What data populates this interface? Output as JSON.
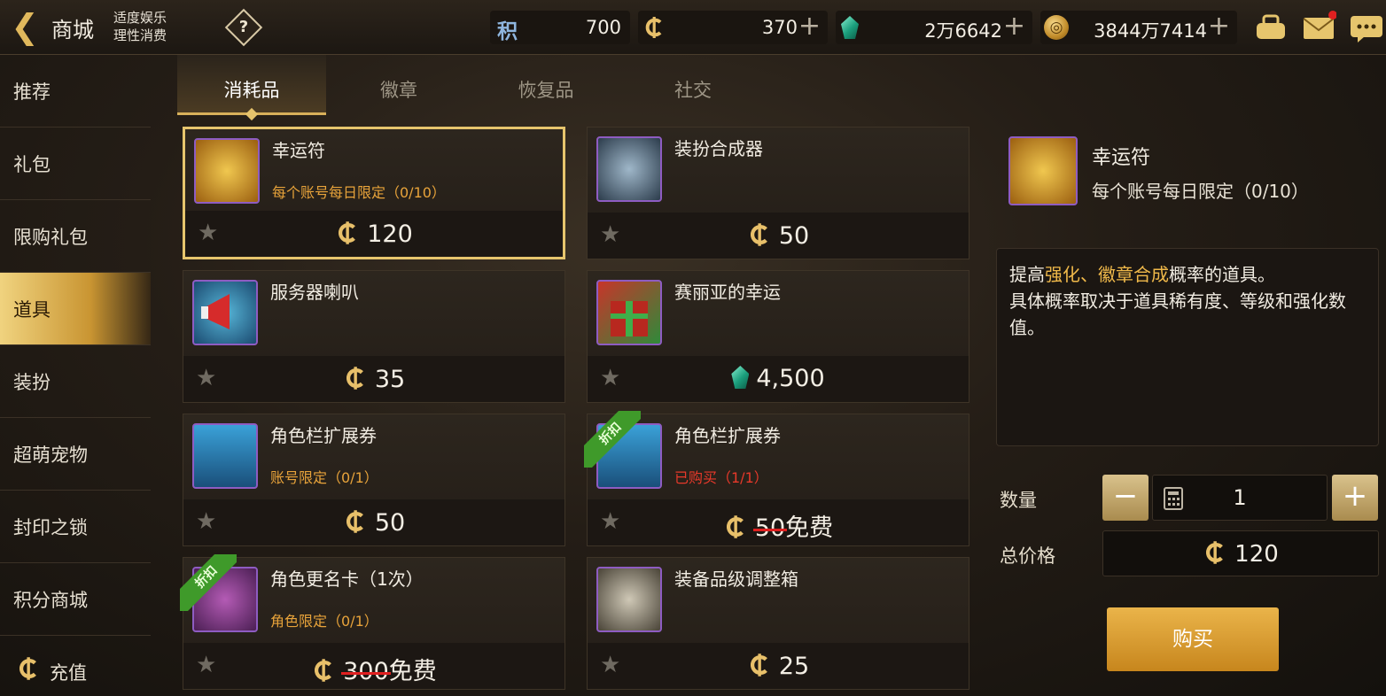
{
  "header": {
    "back_icon": "back-arrow-icon",
    "title": "商城",
    "notice_line1": "适度娱乐",
    "notice_line2": "理性消费",
    "help_icon": "question-icon"
  },
  "currencies": [
    {
      "icon": "points-icon",
      "icon_text": "积",
      "value": "700"
    },
    {
      "icon": "c-coin-icon",
      "value": "370",
      "has_plus": true
    },
    {
      "icon": "gem-icon",
      "value": "2万6642",
      "has_plus": true
    },
    {
      "icon": "gold-coin-icon",
      "value": "3844万7414",
      "has_plus": true
    }
  ],
  "top_icons": [
    "inventory-icon",
    "mail-icon",
    "chat-icon"
  ],
  "sidebar": [
    {
      "label": "推荐"
    },
    {
      "label": "礼包"
    },
    {
      "label": "限购礼包"
    },
    {
      "label": "道具",
      "active": true
    },
    {
      "label": "装扮"
    },
    {
      "label": "超萌宠物"
    },
    {
      "label": "封印之锁"
    },
    {
      "label": "积分商城"
    },
    {
      "label": "充值"
    }
  ],
  "tabs": [
    {
      "label": "消耗品",
      "active": true
    },
    {
      "label": "徽章"
    },
    {
      "label": "恢复品"
    },
    {
      "label": "社交"
    }
  ],
  "items": [
    {
      "name": "幸运符",
      "limit": "每个账号每日限定（0/10）",
      "price": "120",
      "currency": "c"
    },
    {
      "name": "装扮合成器",
      "limit": "",
      "price": "50",
      "currency": "c"
    },
    {
      "name": "服务器喇叭",
      "limit": "",
      "price": "35",
      "currency": "c"
    },
    {
      "name": "赛丽亚的幸运",
      "limit": "",
      "price": "4,500",
      "currency": "gem"
    },
    {
      "name": "角色栏扩展券",
      "limit": "账号限定（0/1）",
      "price": "50",
      "currency": "c"
    },
    {
      "name": "角色栏扩展券",
      "limit": "已购买（1/1）",
      "old_price": "50",
      "price": "免费",
      "currency": "c",
      "ribbon": "折扣"
    },
    {
      "name": "角色更名卡（1次）",
      "limit": "角色限定（0/1）",
      "old_price": "300",
      "price": "免费",
      "currency": "c",
      "ribbon": "折扣"
    },
    {
      "name": "装备品级调整箱",
      "limit": "",
      "price": "25",
      "currency": "c"
    }
  ],
  "detail": {
    "name": "幸运符",
    "limit": "每个账号每日限定（0/10）",
    "desc_pre": "提高",
    "desc_hl": "强化、徽章合成",
    "desc_post": "概率的道具。",
    "desc_line2": "具体概率取决于道具稀有度、等级和强化数值。",
    "quantity_label": "数量",
    "quantity": "1",
    "total_label": "总价格",
    "total": "120",
    "buy_label": "购买"
  },
  "colors": {
    "accent": "#e6c56d",
    "limit_orange": "#e8a33a",
    "limit_red": "#e8392a",
    "ribbon_green": "#3f9a2a"
  }
}
